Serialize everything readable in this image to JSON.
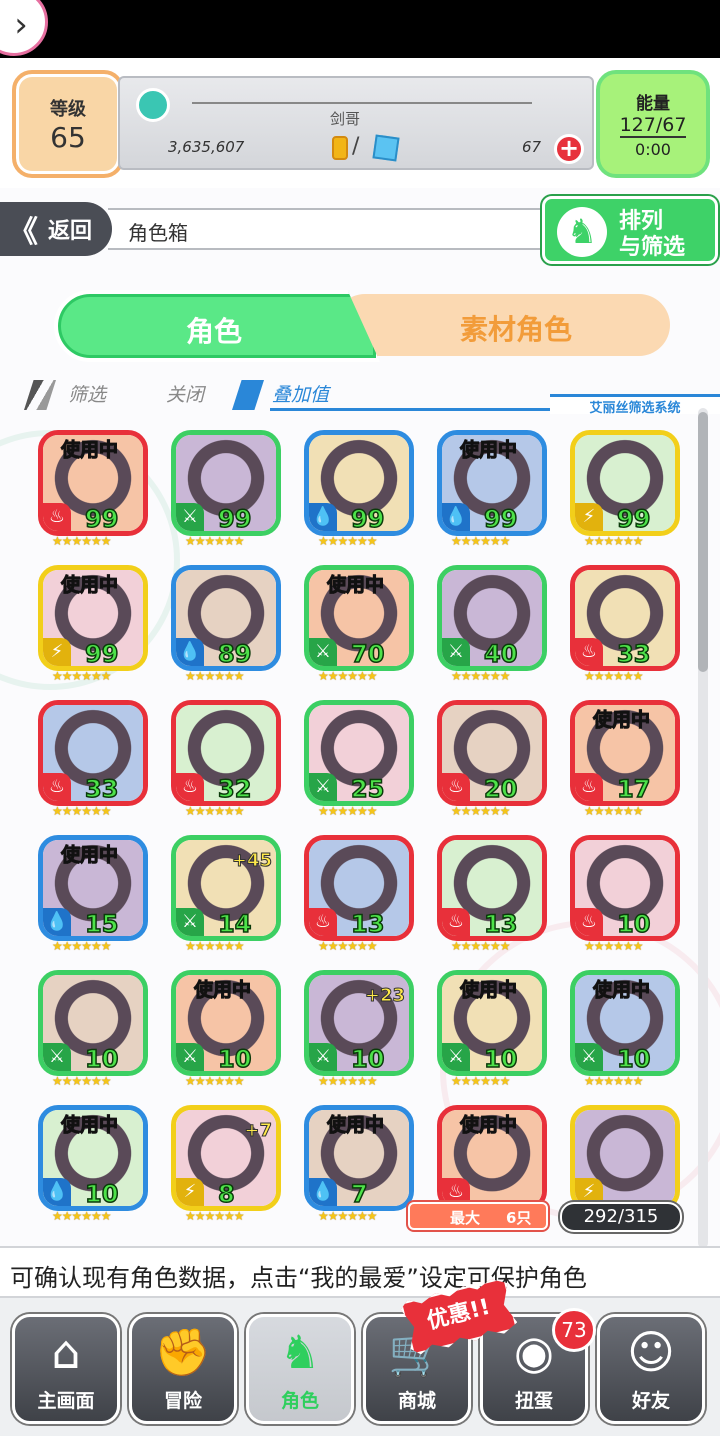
{
  "colors": {
    "accent_green": "#3ed268",
    "fire": "#e8303a",
    "wood": "#3ccf63",
    "water": "#2e8ce0",
    "light": "#f2cf1a"
  },
  "header": {
    "back_icon": "chevron-right-icon",
    "level_label": "等级",
    "level_value": "65",
    "player_name": "剑哥",
    "gold": "3,635,607",
    "slash": "/",
    "stones": "67",
    "plus_label": "+",
    "energy_label": "能量",
    "energy_value": "127/67",
    "energy_timer": "0:00"
  },
  "nav": {
    "back_label": "返回",
    "back_chevron": "《",
    "title": "角色箱",
    "sort_line1": "排列",
    "sort_line2": "与筛选"
  },
  "tabs": {
    "active": "角色",
    "other": "素材角色"
  },
  "filter": {
    "filter_label": "筛选",
    "off_label": "关闭",
    "stack_label": "叠加值",
    "system_label": "艾丽丝筛选系统"
  },
  "grid": {
    "in_use_label": "使用中",
    "cards": [
      {
        "element": "fire",
        "level": "99",
        "stars": "★★★★★★",
        "in_use": true,
        "plus": ""
      },
      {
        "element": "wood",
        "level": "99",
        "stars": "★★★★★★",
        "in_use": false,
        "plus": ""
      },
      {
        "element": "water",
        "level": "99",
        "stars": "★★★★★★",
        "in_use": false,
        "plus": ""
      },
      {
        "element": "water",
        "level": "99",
        "stars": "★★★★★★",
        "in_use": true,
        "plus": ""
      },
      {
        "element": "light",
        "level": "99",
        "stars": "★★★★★★",
        "in_use": false,
        "plus": ""
      },
      {
        "element": "light",
        "level": "99",
        "stars": "★★★★★★",
        "in_use": true,
        "plus": ""
      },
      {
        "element": "water",
        "level": "89",
        "stars": "★★★★★★",
        "in_use": false,
        "plus": ""
      },
      {
        "element": "wood",
        "level": "70",
        "stars": "★★★★★★",
        "in_use": true,
        "plus": ""
      },
      {
        "element": "wood",
        "level": "40",
        "stars": "★★★★★★",
        "in_use": false,
        "plus": ""
      },
      {
        "element": "fire",
        "level": "33",
        "stars": "★★★★★★",
        "in_use": false,
        "plus": ""
      },
      {
        "element": "fire",
        "level": "33",
        "stars": "★★★★★★",
        "in_use": false,
        "plus": ""
      },
      {
        "element": "fire",
        "level": "32",
        "stars": "★★★★★★",
        "in_use": false,
        "plus": ""
      },
      {
        "element": "wood",
        "level": "25",
        "stars": "★★★★★★",
        "in_use": false,
        "plus": ""
      },
      {
        "element": "fire",
        "level": "20",
        "stars": "★★★★★★",
        "in_use": false,
        "plus": ""
      },
      {
        "element": "fire",
        "level": "17",
        "stars": "★★★★★★",
        "in_use": true,
        "plus": ""
      },
      {
        "element": "water",
        "level": "15",
        "stars": "★★★★★★",
        "in_use": true,
        "plus": ""
      },
      {
        "element": "wood",
        "level": "14",
        "stars": "★★★★★★",
        "in_use": false,
        "plus": "+45"
      },
      {
        "element": "fire",
        "level": "13",
        "stars": "★★★★★★",
        "in_use": false,
        "plus": ""
      },
      {
        "element": "fire",
        "level": "13",
        "stars": "★★★★★★",
        "in_use": false,
        "plus": ""
      },
      {
        "element": "fire",
        "level": "10",
        "stars": "★★★★★★",
        "in_use": false,
        "plus": ""
      },
      {
        "element": "wood",
        "level": "10",
        "stars": "★★★★★★",
        "in_use": false,
        "plus": ""
      },
      {
        "element": "wood",
        "level": "10",
        "stars": "★★★★★★",
        "in_use": true,
        "plus": ""
      },
      {
        "element": "wood",
        "level": "10",
        "stars": "★★★★★★",
        "in_use": false,
        "plus": "+23"
      },
      {
        "element": "wood",
        "level": "10",
        "stars": "★★★★★★",
        "in_use": true,
        "plus": ""
      },
      {
        "element": "wood",
        "level": "10",
        "stars": "★★★★★★",
        "in_use": true,
        "plus": ""
      },
      {
        "element": "water",
        "level": "10",
        "stars": "★★★★★★",
        "in_use": true,
        "plus": ""
      },
      {
        "element": "light",
        "level": "8",
        "stars": "★★★★★★",
        "in_use": false,
        "plus": "+7"
      },
      {
        "element": "water",
        "level": "7",
        "stars": "★★★★★★",
        "in_use": true,
        "plus": ""
      },
      {
        "element": "fire",
        "level": "",
        "stars": "",
        "in_use": true,
        "plus": ""
      },
      {
        "element": "light",
        "level": "",
        "stars": "",
        "in_use": false,
        "plus": ""
      }
    ],
    "max_label": "最大",
    "max_value": "6只",
    "count": "292/315"
  },
  "ticker": "可确认现有角色数据，点击“我的最爱”设定可保护角色",
  "bottom_nav": [
    {
      "label": "主画面",
      "icon": "home-icon",
      "glyph": "⌂"
    },
    {
      "label": "冒险",
      "icon": "handshake-icon",
      "glyph": "✊"
    },
    {
      "label": "角色",
      "icon": "rabbit-icon",
      "glyph": "♞"
    },
    {
      "label": "商城",
      "icon": "cart-icon",
      "glyph": "🛒"
    },
    {
      "label": "扭蛋",
      "icon": "egg-icon",
      "glyph": "◉"
    },
    {
      "label": "好友",
      "icon": "friends-icon",
      "glyph": "☺"
    }
  ],
  "sale_tag": "优惠!!",
  "gacha_badge": "73"
}
